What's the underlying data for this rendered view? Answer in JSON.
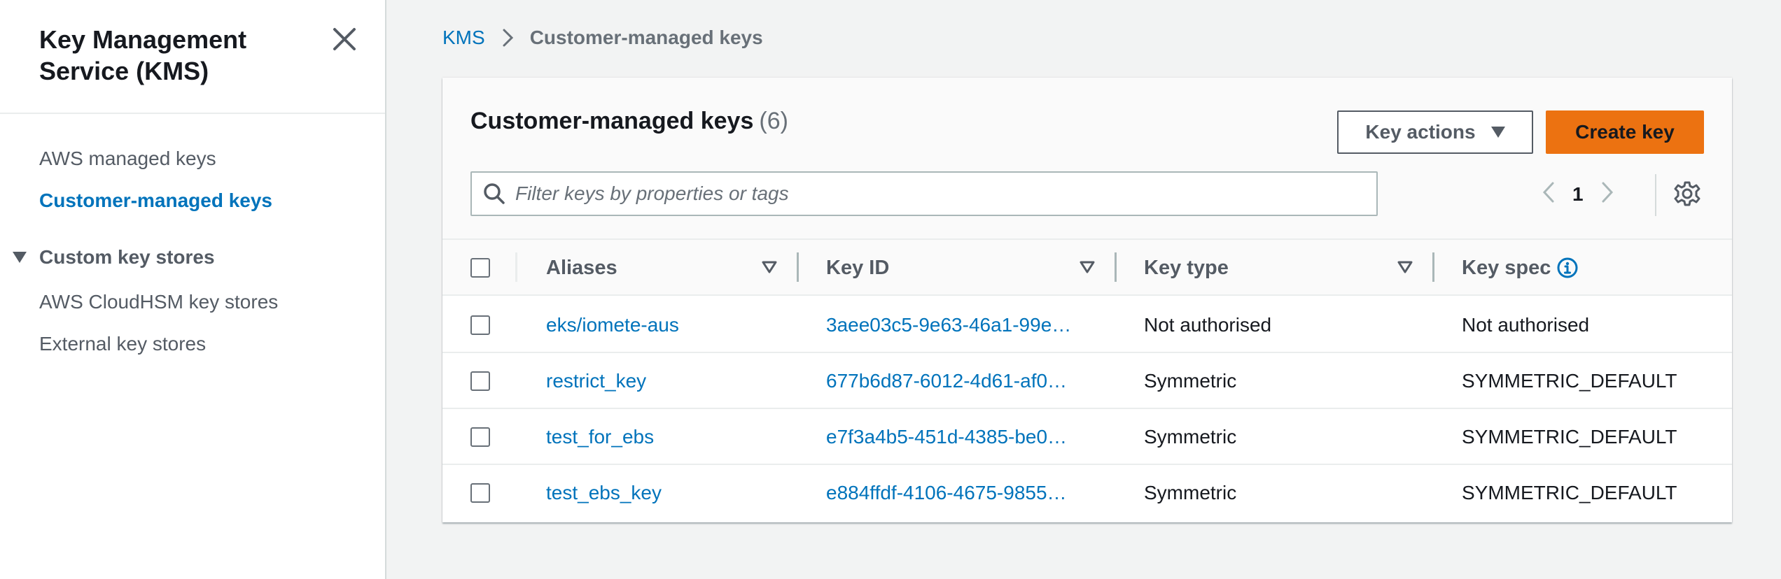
{
  "sidebar": {
    "title": "Key Management Service (KMS)",
    "links": [
      {
        "label": "AWS managed keys",
        "active": false
      },
      {
        "label": "Customer-managed keys",
        "active": true
      }
    ],
    "section": {
      "label": "Custom key stores",
      "items": [
        "AWS CloudHSM key stores",
        "External key stores"
      ]
    }
  },
  "breadcrumb": {
    "root": "KMS",
    "current": "Customer-managed keys"
  },
  "panel": {
    "title": "Customer-managed keys",
    "count": "(6)",
    "key_actions_label": "Key actions",
    "create_key_label": "Create key",
    "search_placeholder": "Filter keys by properties or tags",
    "current_page": "1"
  },
  "table": {
    "columns": [
      "Aliases",
      "Key ID",
      "Key type",
      "Key spec"
    ],
    "rows": [
      {
        "alias": "eks/iomete-aus",
        "key_id": "3aee03c5-9e63-46a1-99e…",
        "key_type": "Not authorised",
        "key_spec": "Not authorised"
      },
      {
        "alias": "restrict_key",
        "key_id": "677b6d87-6012-4d61-af0…",
        "key_type": "Symmetric",
        "key_spec": "SYMMETRIC_DEFAULT"
      },
      {
        "alias": "test_for_ebs",
        "key_id": "e7f3a4b5-451d-4385-be0…",
        "key_type": "Symmetric",
        "key_spec": "SYMMETRIC_DEFAULT"
      },
      {
        "alias": "test_ebs_key",
        "key_id": "e884ffdf-4106-4675-9855…",
        "key_type": "Symmetric",
        "key_spec": "SYMMETRIC_DEFAULT"
      }
    ]
  },
  "colors": {
    "link": "#0073bb",
    "primary_button": "#ec7211",
    "text": "#16191f",
    "muted": "#545b64"
  },
  "icons": [
    "close-icon",
    "chevron-right-icon",
    "search-icon",
    "chevron-left-icon",
    "settings-gear-icon",
    "sort-caret-icon",
    "info-icon",
    "caret-down-icon",
    "expand-triangle-icon"
  ]
}
